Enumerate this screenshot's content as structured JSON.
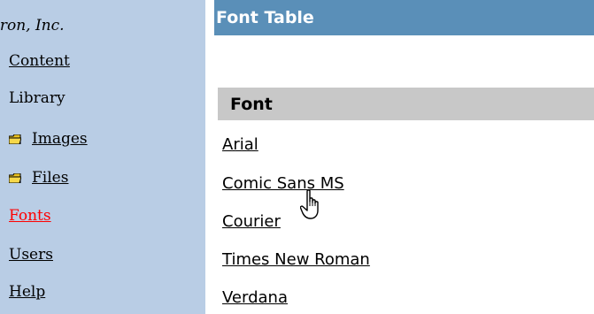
{
  "sidebar": {
    "company": "tron, Inc.",
    "items": [
      {
        "label": "Content"
      },
      {
        "label": "Library"
      },
      {
        "label": "Images",
        "icon": "folder-icon"
      },
      {
        "label": "Files",
        "icon": "folder-icon"
      },
      {
        "label": "Fonts",
        "active": true
      },
      {
        "label": "Users"
      },
      {
        "label": "Help"
      }
    ]
  },
  "main": {
    "title": "Font Table",
    "column_header": "Font",
    "fonts": [
      "Arial",
      "Comic Sans MS",
      "Courier",
      "Times New Roman",
      "Verdana"
    ]
  },
  "cursor": {
    "icon": "hand-pointer-icon"
  },
  "colors": {
    "sidebar_bg": "#b9cde5",
    "title_bar_bg": "#5a8fb8",
    "header_bg": "#c8c8c8",
    "active_link": "#ff0000"
  }
}
